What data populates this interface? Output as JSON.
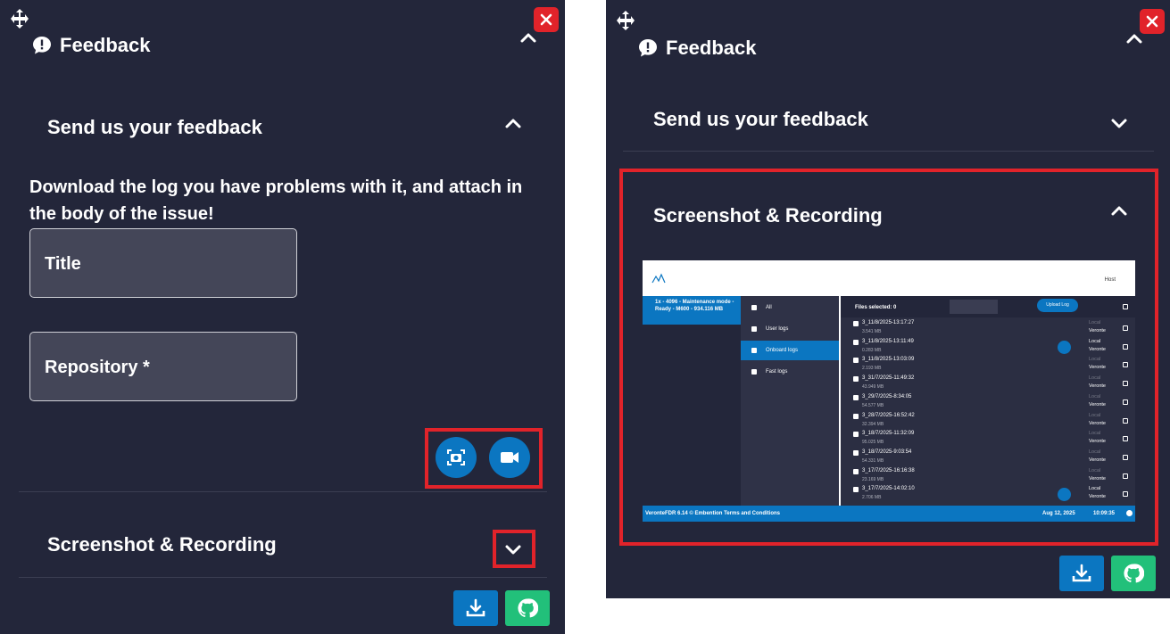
{
  "colors": {
    "panel_bg": "#23263a",
    "accent_blue": "#0b76c1",
    "github_green": "#22c07a",
    "highlight_red": "#e1232a"
  },
  "left_panel": {
    "header": {
      "title": "Feedback",
      "icon": "feedback-exclamation-icon"
    },
    "send_section": {
      "title": "Send us your feedback",
      "description": "Download the log you have problems with it, and attach in the body of the issue!",
      "title_field": {
        "placeholder": "Title"
      },
      "repository_field": {
        "placeholder": "Repository *"
      },
      "screenshot_button": {
        "icon": "camera-icon"
      },
      "record_button": {
        "icon": "video-camera-icon"
      }
    },
    "screenshot_section": {
      "title": "Screenshot & Recording"
    },
    "bottom_buttons": [
      {
        "icon": "download-icon"
      },
      {
        "icon": "github-icon"
      }
    ]
  },
  "right_panel": {
    "header": {
      "title": "Feedback",
      "icon": "feedback-exclamation-icon"
    },
    "send_section": {
      "title": "Send us your feedback"
    },
    "screenshot_section": {
      "title": "Screenshot & Recording"
    },
    "preview": {
      "host_label": "Host",
      "device_info": "1x - 4096 - Maintenance mode - Ready - M600 - 934.116 MB",
      "nav_items": [
        "All",
        "User logs",
        "Onboard logs",
        "Fast logs"
      ],
      "active_nav": 2,
      "files_selected": "Files selected: 0",
      "upload_label": "Upload Log",
      "logs": [
        {
          "name": "3_11/8/2025-13:17:27",
          "size": "3.541 MB",
          "local": "Local",
          "remote": "Veronte"
        },
        {
          "name": "3_11/8/2025-13:11:49",
          "size": "0.283 MB",
          "local": "Local",
          "remote": "Veronte"
        },
        {
          "name": "3_11/8/2025-13:03:09",
          "size": "2.193 MB",
          "local": "Local",
          "remote": "Veronte"
        },
        {
          "name": "3_31/7/2025-11:49:32",
          "size": "43.949 MB",
          "local": "Local",
          "remote": "Veronte"
        },
        {
          "name": "3_29/7/2025-8:34:05",
          "size": "54.577 MB",
          "local": "Local",
          "remote": "Veronte"
        },
        {
          "name": "3_28/7/2025-16:52:42",
          "size": "32.394 MB",
          "local": "Local",
          "remote": "Veronte"
        },
        {
          "name": "3_18/7/2025-11:32:09",
          "size": "95.025 MB",
          "local": "Local",
          "remote": "Veronte"
        },
        {
          "name": "3_18/7/2025-9:03:54",
          "size": "54.331 MB",
          "local": "Local",
          "remote": "Veronte"
        },
        {
          "name": "3_17/7/2025-16:16:38",
          "size": "23.169 MB",
          "local": "Local",
          "remote": "Veronte"
        },
        {
          "name": "3_17/7/2025-14:02:10",
          "size": "2.706 MB",
          "local": "Local",
          "remote": "Veronte"
        }
      ],
      "footer": {
        "version": "VeronteFDR 6.14 © Embention  Terms and Conditions",
        "date": "Aug 12, 2025",
        "time": "10:09:35"
      }
    },
    "bottom_buttons": [
      {
        "icon": "download-icon"
      },
      {
        "icon": "github-icon"
      }
    ]
  }
}
